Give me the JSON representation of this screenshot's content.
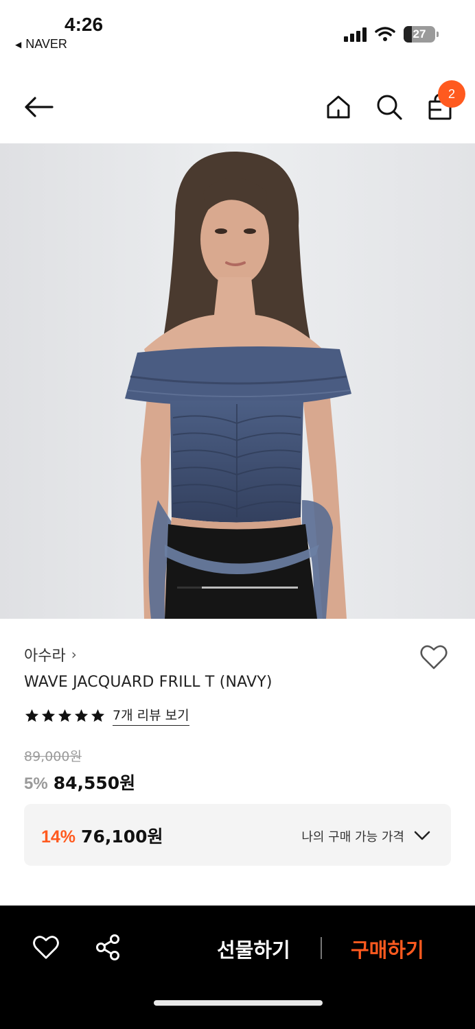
{
  "status_bar": {
    "time": "4:26",
    "back_app": "NAVER",
    "battery": "27"
  },
  "nav": {
    "cart_count": "2"
  },
  "product": {
    "brand": "아수라",
    "title": "WAVE JACQUARD FRILL T (NAVY)",
    "rating_stars": 5,
    "review_link": "7개 리뷰 보기",
    "original_price": "89,000원",
    "discount_rate": "5%",
    "sale_price": "84,550원"
  },
  "my_price": {
    "discount_rate": "14%",
    "price": "76,100원",
    "label": "나의 구매 가능 가격"
  },
  "bottom_bar": {
    "gift_label": "선물하기",
    "buy_label": "구매하기"
  },
  "image_slider": {
    "current_index_fraction": 0.2
  },
  "colors": {
    "accent": "#ff5a1f",
    "bottom_bar_bg": "#000000"
  }
}
